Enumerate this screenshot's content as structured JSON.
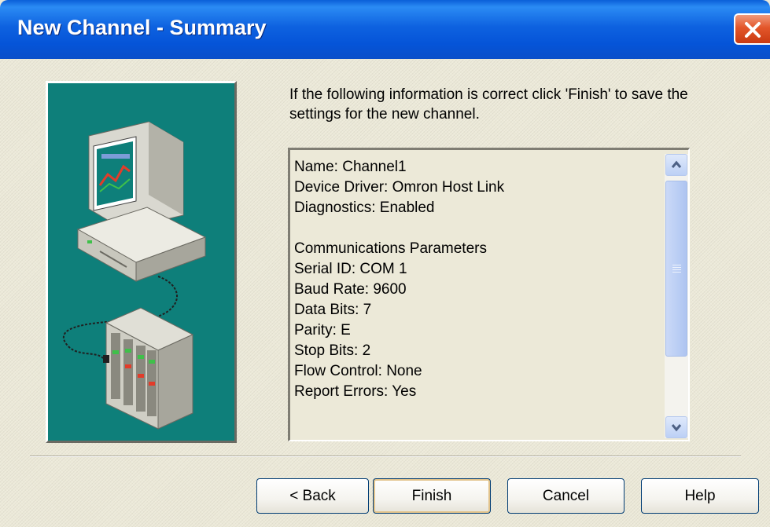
{
  "window": {
    "title": "New Channel - Summary"
  },
  "intro_text": "If the following information is correct click 'Finish' to save the settings for the new channel.",
  "summary": {
    "lines": [
      "Name: Channel1",
      "Device Driver: Omron Host Link",
      "Diagnostics: Enabled",
      "",
      "Communications Parameters",
      "Serial ID: COM 1",
      "Baud Rate: 9600",
      "Data Bits: 7",
      "Parity: E",
      "Stop Bits: 2",
      "Flow Control: None",
      "Report Errors: Yes"
    ]
  },
  "buttons": {
    "back": "< Back",
    "finish": "Finish",
    "cancel": "Cancel",
    "help": "Help"
  },
  "colors": {
    "title_bar": "#0a5fd8",
    "illustration_bg": "#0e7f7a",
    "dialog_bg": "#ece9d8"
  },
  "icons": {
    "close": "close-icon",
    "illustration": "computer-plc-network-illustration"
  }
}
